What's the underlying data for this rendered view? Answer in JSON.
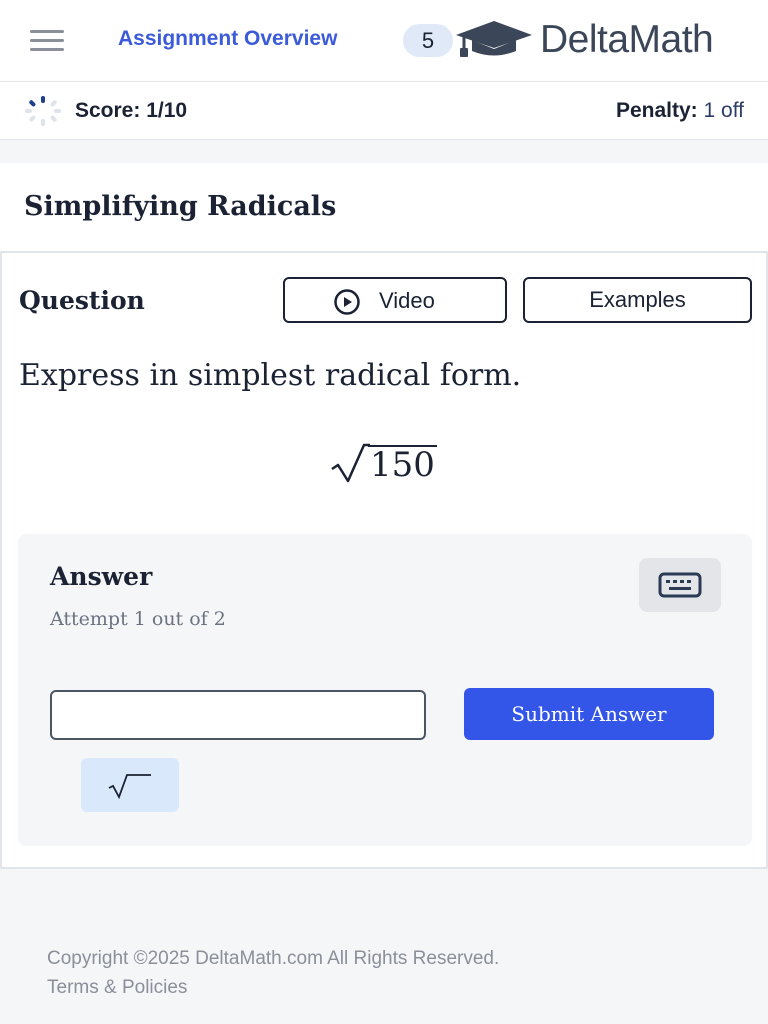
{
  "header": {
    "menu_icon": "hamburger-menu-icon",
    "assignment_link": "Assignment Overview",
    "problem_count": "5",
    "logo_icon": "graduation-cap-icon",
    "logo_text": "DeltaMath"
  },
  "scorebar": {
    "score_icon": "progress-ring-icon",
    "score": "Score: 1/10",
    "penalty_label": "Penalty:",
    "penalty_value": "1 off"
  },
  "problem": {
    "title": "Simplifying Radicals",
    "question_label": "Question",
    "video_icon": "play-circle-icon",
    "video_label": "Video",
    "examples_label": "Examples",
    "prompt": "Express in simplest radical form.",
    "radicand": "150"
  },
  "answer": {
    "title": "Answer",
    "attempt": "Attempt 1 out of 2",
    "keyboard_icon": "keyboard-icon",
    "input_value": "",
    "submit_label": "Submit Answer",
    "sqrt_key_icon": "square-root-icon"
  },
  "footer": {
    "copyright": "Copyright ©2025 DeltaMath.com All Rights Reserved.",
    "terms": "Terms & Policies"
  },
  "colors": {
    "brand_blue": "#3b5bdb",
    "submit_blue": "#3355e8",
    "badge_bg": "#dfe9f7",
    "key_bg": "#d9e8fb"
  }
}
